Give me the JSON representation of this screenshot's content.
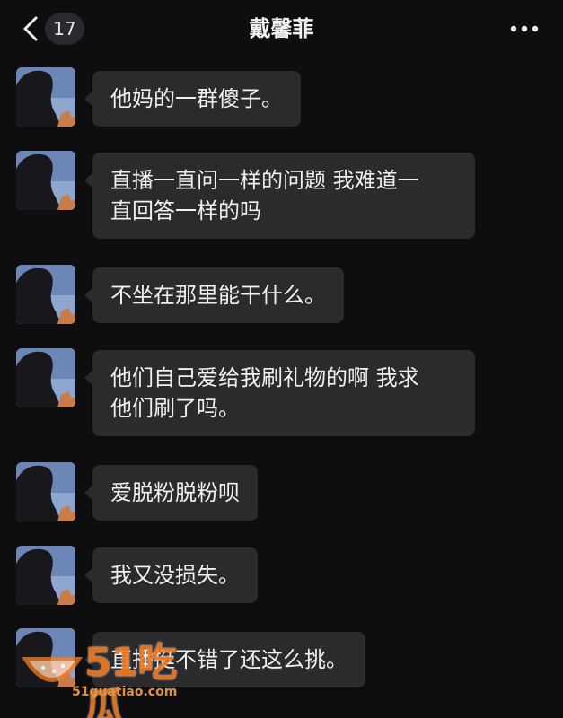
{
  "header": {
    "badge_count": "17",
    "title": "戴馨菲"
  },
  "messages": [
    {
      "text": "他妈的一群傻子。"
    },
    {
      "text": "直播一直问一样的问题 我难道一\n直回答一样的吗"
    },
    {
      "text": "不坐在那里能干什么。"
    },
    {
      "text": "他们自己爱给我刷礼物的啊 我求\n他们刷了吗。"
    },
    {
      "text": "爱脱粉脱粉呗"
    },
    {
      "text": "我又没损失。"
    },
    {
      "text": "直播挺不错了还这么挑。"
    }
  ],
  "watermark": {
    "brand": "51吃瓜",
    "url": "51guatiao.com"
  },
  "colors": {
    "background": "#0e0e10",
    "bubble": "#2b2b2e",
    "text": "#f0f0f0",
    "watermark": "#f47b20"
  },
  "icons": {
    "back": "chevron-left-icon",
    "more": "more-horizontal-icon"
  }
}
